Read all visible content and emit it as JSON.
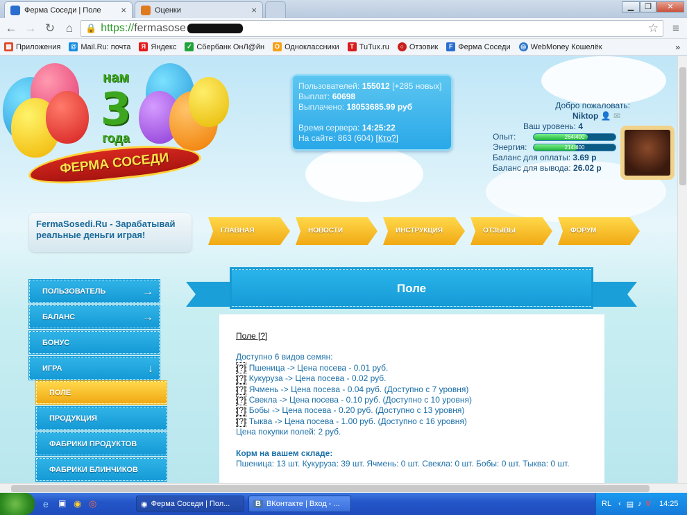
{
  "browser": {
    "tabs": [
      {
        "label": "Ферма Соседи | Поле"
      },
      {
        "label": "Оценки"
      }
    ],
    "url": {
      "scheme": "https://",
      "host": "fermasose"
    },
    "bookmarks": [
      {
        "label": "Приложения",
        "icon": "apps-icon",
        "color": "#e04a2a"
      },
      {
        "label": "Mail.Ru: почта",
        "icon": "mailru-icon",
        "color": "#168de2"
      },
      {
        "label": "Яндекс",
        "icon": "yandex-icon",
        "color": "#e51c1c"
      },
      {
        "label": "Сбербанк ОнЛ@йн",
        "icon": "sberbank-icon",
        "color": "#22a23b"
      },
      {
        "label": "Одноклассники",
        "icon": "ok-icon",
        "color": "#f5a11a"
      },
      {
        "label": "TuTux.ru",
        "icon": "tutux-icon",
        "color": "#d71d1d"
      },
      {
        "label": "Отзовик",
        "icon": "otzovik-icon",
        "color": "#c8201e"
      },
      {
        "label": "Ферма Соседи",
        "icon": "ferma-icon",
        "color": "#2a6fd0"
      },
      {
        "label": "WebMoney Кошелёк",
        "icon": "webmoney-icon",
        "color": "#2d77c9"
      }
    ]
  },
  "logo": {
    "nam": "нам",
    "three": "3",
    "goda": "года",
    "ribbon": "ФЕРМА СОСЕДИ"
  },
  "stats": {
    "users_label": "Пользователей:",
    "users": "155012",
    "users_new": "[+285 новых]",
    "payouts_label": "Выплат:",
    "payouts": "60698",
    "paid_label": "Выплачено:",
    "paid": "18053685.99 руб",
    "time_label": "Время сервера:",
    "time": "14:25:22",
    "online_label": "На сайте:",
    "online": "863 (604)",
    "who": "[Кто?]"
  },
  "user": {
    "welcome": "Добро пожаловать:",
    "name": "Niktop",
    "level_label": "Ваш уровень:",
    "level": "4",
    "exp_label": "Опыт:",
    "exp_text": "264/400",
    "exp_fraction": 0.66,
    "energy_label": "Энергия:",
    "energy_text": "214/400",
    "energy_fraction": 0.535,
    "balance_pay_label": "Баланс для оплаты:",
    "balance_pay": "3.69 р",
    "balance_out_label": "Баланс для вывода:",
    "balance_out": "26.02 р"
  },
  "slogan": "FermaSosedi.Ru - Зарабатывай реальные деньги играя!",
  "menu": [
    "ГЛАВНАЯ",
    "НОВОСТИ",
    "ИНСТРУКЦИЯ",
    "ОТЗЫВЫ",
    "ФОРУМ"
  ],
  "sidebar": [
    {
      "label": "ПОЛЬЗОВАТЕЛЬ",
      "arrow": "→"
    },
    {
      "label": "БАЛАНС",
      "arrow": "→"
    },
    {
      "label": "БОНУС",
      "arrow": ""
    },
    {
      "label": "ИГРА",
      "arrow": "↓"
    },
    {
      "label": "ПОЛЕ",
      "arrow": ""
    },
    {
      "label": "ПРОДУКЦИЯ",
      "arrow": ""
    },
    {
      "label": "ФАБРИКИ ПРОДУКТОВ",
      "arrow": ""
    },
    {
      "label": "ФАБРИКИ БЛИНЧИКОВ",
      "arrow": ""
    }
  ],
  "page_title": "Поле",
  "content": {
    "heading": "Поле [?]",
    "intro": "Доступно 6 видов семян:",
    "seeds": [
      "Пшеница -> Цена посева - 0.01 руб.",
      "Кукуруза -> Цена посева - 0.02 руб.",
      "Ячмень -> Цена посева - 0.04 руб. (Доступно с 7 уровня)",
      "Свекла -> Цена посева - 0.10 руб. (Доступно с 10 уровня)",
      "Бобы -> Цена посева - 0.20 руб. (Доступно с 13 уровня)",
      "Тыква -> Цена посева - 1.00 руб. (Доступно с 16 уровня)"
    ],
    "q": "[?]",
    "field_price": "Цена покупки полей: 2 руб.",
    "feed_heading": "Корм на вашем складе:",
    "feed": "Пшеница: 13 шт. Кукуруза: 39 шт. Ячмень: 0 шт. Свекла: 0 шт. Бобы: 0 шт. Тыква: 0 шт."
  },
  "taskbar": {
    "tasks": [
      "Ферма Соседи | Пол...",
      "ВКонтакте | Вход - ..."
    ],
    "lang": "RL",
    "clock": "14:25"
  }
}
